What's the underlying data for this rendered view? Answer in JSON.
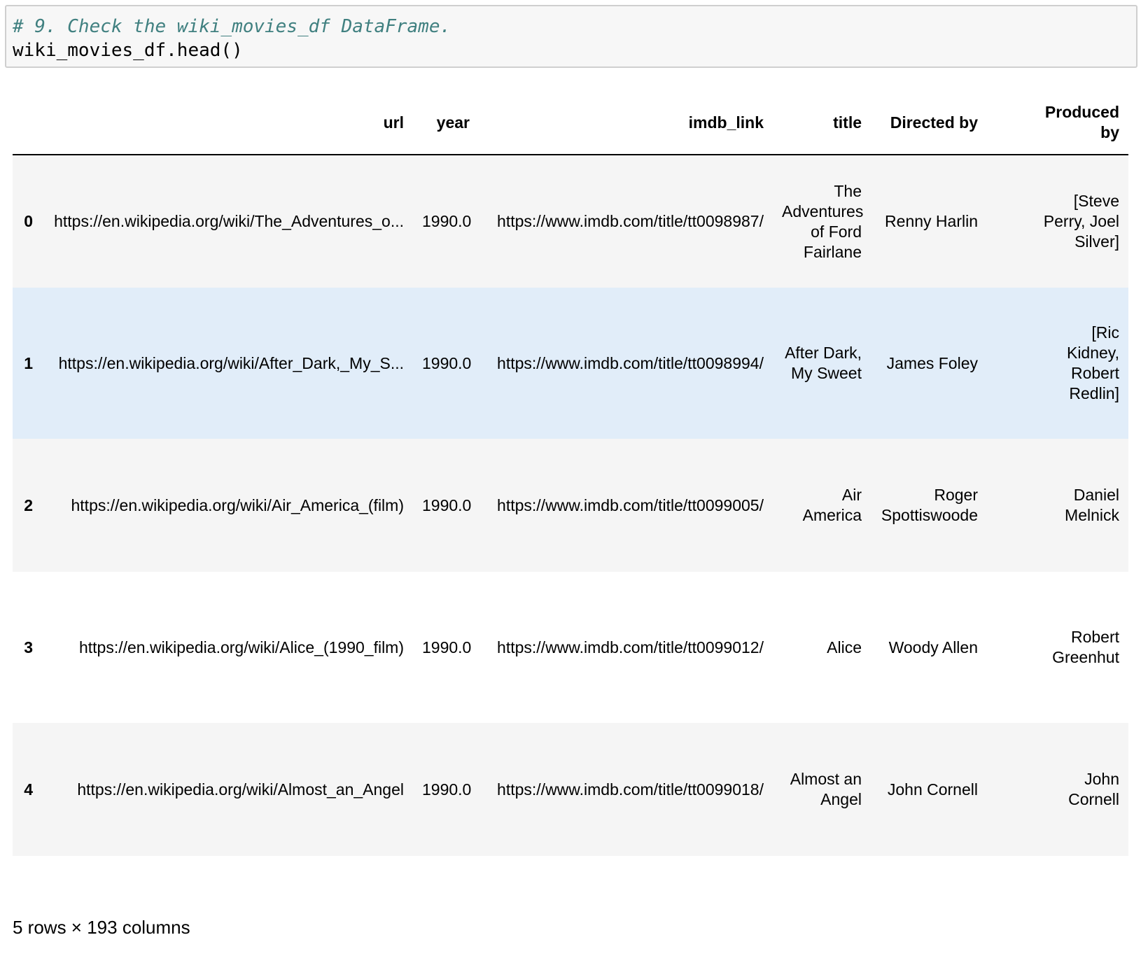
{
  "code": {
    "comment": "# 9. Check the wiki_movies_df DataFrame.",
    "line": "wiki_movies_df.head()"
  },
  "table": {
    "columns": [
      "",
      "url",
      "year",
      "imdb_link",
      "title",
      "Directed by",
      "Produced by"
    ],
    "rows": [
      {
        "index": "0",
        "url": "https://en.wikipedia.org/wiki/The_Adventures_o...",
        "year": "1990.0",
        "imdb_link": "https://www.imdb.com/title/tt0098987/",
        "title": "The Adventures of Ford Fairlane",
        "directed_by": "Renny Harlin",
        "produced_by": "[Steve Perry, Joel Silver]"
      },
      {
        "index": "1",
        "url": "https://en.wikipedia.org/wiki/After_Dark,_My_S...",
        "year": "1990.0",
        "imdb_link": "https://www.imdb.com/title/tt0098994/",
        "title": "After Dark, My Sweet",
        "directed_by": "James Foley",
        "produced_by": "[Ric Kidney, Robert Redlin]"
      },
      {
        "index": "2",
        "url": "https://en.wikipedia.org/wiki/Air_America_(film)",
        "year": "1990.0",
        "imdb_link": "https://www.imdb.com/title/tt0099005/",
        "title": "Air America",
        "directed_by": "Roger Spottiswoode",
        "produced_by": "Daniel Melnick"
      },
      {
        "index": "3",
        "url": "https://en.wikipedia.org/wiki/Alice_(1990_film)",
        "year": "1990.0",
        "imdb_link": "https://www.imdb.com/title/tt0099012/",
        "title": "Alice",
        "directed_by": "Woody Allen",
        "produced_by": "Robert Greenhut"
      },
      {
        "index": "4",
        "url": "https://en.wikipedia.org/wiki/Almost_an_Angel",
        "year": "1990.0",
        "imdb_link": "https://www.imdb.com/title/tt0099018/",
        "title": "Almost an Angel",
        "directed_by": "John Cornell",
        "produced_by": "John Cornell"
      }
    ]
  },
  "footer": "5 rows × 193 columns",
  "colors": {
    "comment": "#408080",
    "hover_row": "#e1edf9",
    "striped_row": "#f5f5f5"
  }
}
